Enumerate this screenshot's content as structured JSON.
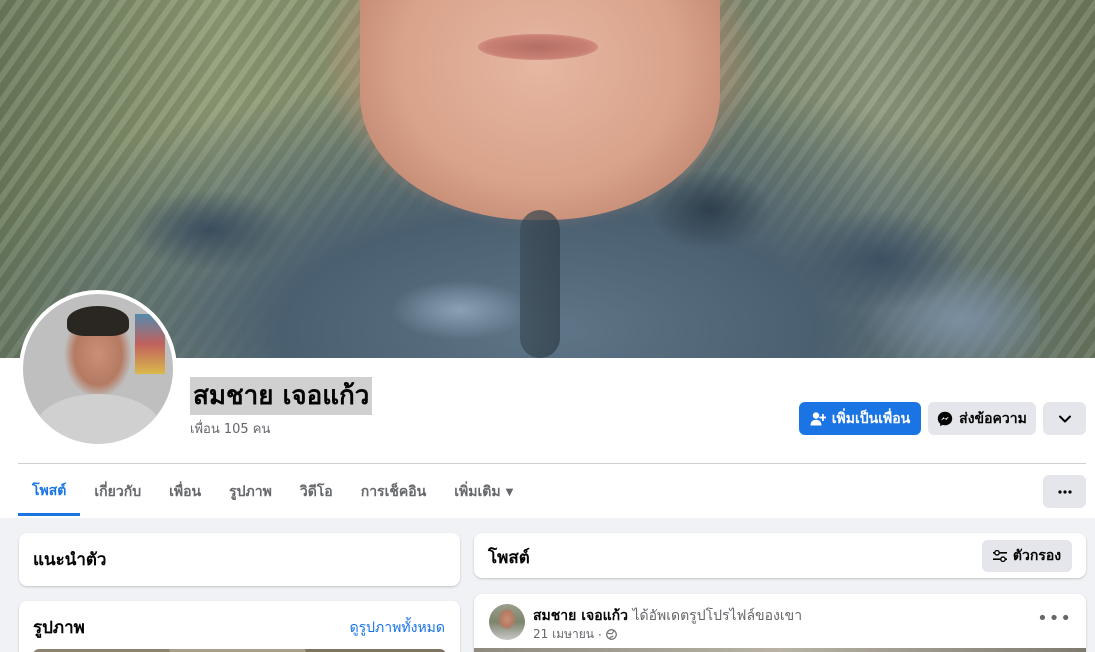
{
  "profile": {
    "name": "สมชาย เจอแก้ว",
    "friends": "เพื่อน 105 คน"
  },
  "actions": {
    "add_friend": "เพิ่มเป็นเพื่อน",
    "message": "ส่งข้อความ"
  },
  "tabs": [
    {
      "label": "โพสต์",
      "active": true
    },
    {
      "label": "เกี่ยวกับ"
    },
    {
      "label": "เพื่อน"
    },
    {
      "label": "รูปภาพ"
    },
    {
      "label": "วิดีโอ"
    },
    {
      "label": "การเช็คอิน"
    },
    {
      "label": "เพิ่มเติม"
    }
  ],
  "intro": {
    "title": "แนะนำตัว"
  },
  "photos": {
    "title": "รูปภาพ",
    "see_all": "ดูรูปภาพทั้งหมด"
  },
  "posts": {
    "title": "โพสต์",
    "filter": "ตัวกรอง"
  },
  "post": {
    "author": "สมชาย เจอแก้ว",
    "action": "ได้อัพเดตรูปโปรไฟล์ของเขา",
    "date": "21 เมษายน",
    "privacy_icon": "globe-icon"
  },
  "colors": {
    "accent": "#1b74e4",
    "button_gray": "#e4e6eb",
    "background": "#f0f2f5"
  }
}
